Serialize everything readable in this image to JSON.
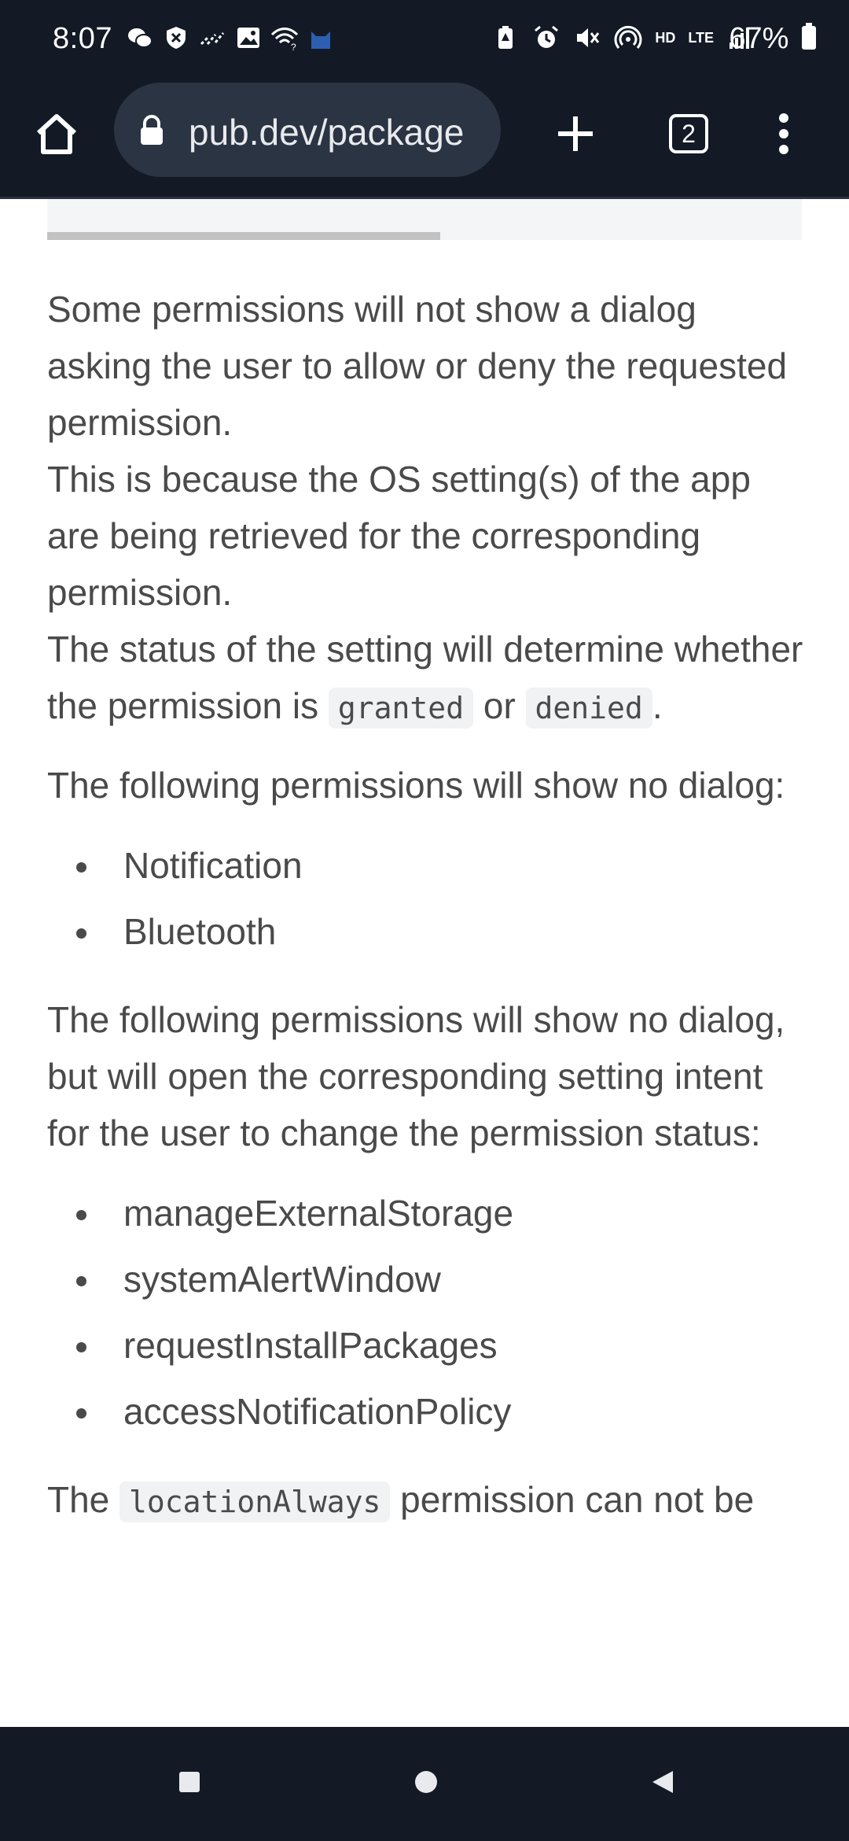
{
  "status_bar": {
    "time": "8:07",
    "network_hd": "HD",
    "network_lte": "LTE",
    "battery_percent": "67%",
    "left_icons": [
      "wechat-icon",
      "shield-icon",
      "signal-dots-icon",
      "image-icon",
      "wifi-question-icon",
      "cat-icon"
    ],
    "right_icons": [
      "battery-saver-icon",
      "alarm-icon",
      "mute-icon",
      "hotspot-icon",
      "signal-bars-icon",
      "battery-icon"
    ]
  },
  "toolbar": {
    "url": "pub.dev/package",
    "tab_count": "2",
    "home_icon": "home-icon",
    "new_tab_icon": "plus-icon",
    "menu_icon": "more-vert-icon"
  },
  "content": {
    "para1": {
      "line_a": "Some permissions will not show a dialog asking the user to allow or deny the requested permission.",
      "line_b": "This is because the OS setting(s) of the app are being retrieved for the corresponding permission.",
      "line_c_before": "The status of the setting will determine whether the permission is ",
      "code_granted": "granted",
      "line_c_mid": " or ",
      "code_denied": "denied",
      "line_c_after": "."
    },
    "para2": "The following permissions will show no dialog:",
    "list1": [
      "Notification",
      "Bluetooth"
    ],
    "para3": "The following permissions will show no dialog, but will open the corresponding setting intent for the user to change the permission status:",
    "list2": [
      "manageExternalStorage",
      "systemAlertWindow",
      "requestInstallPackages",
      "accessNotificationPolicy"
    ],
    "para4": {
      "before": "The ",
      "code": "locationAlways",
      "after": " permission can not be"
    }
  },
  "nav_bar": {
    "icons": [
      "recents-icon",
      "home-circle-icon",
      "back-icon"
    ]
  },
  "colors": {
    "chrome_bg": "#131a26",
    "omnibox_bg": "#2a3443",
    "text": "#4a4a4a",
    "code_bg": "#f1f2f4"
  }
}
